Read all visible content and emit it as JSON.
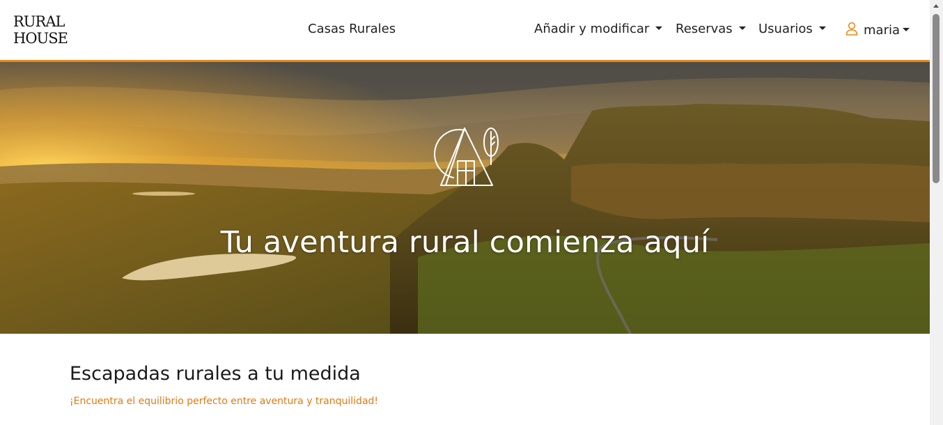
{
  "brand": {
    "line1": "RURAL",
    "line2": "HOUSE"
  },
  "nav": {
    "center_link": "Casas Rurales",
    "dropdowns": [
      {
        "label": "Añadir y modificar"
      },
      {
        "label": "Reservas"
      },
      {
        "label": "Usuarios"
      }
    ],
    "user": {
      "label": "maria",
      "icon": "user-icon"
    }
  },
  "hero": {
    "title": "Tu aventura rural comienza aquí",
    "logo_icon": "cabin-tree-logo-icon"
  },
  "content": {
    "title": "Escapadas rurales a tu medida",
    "subtitle": "¡Encuentra el equilibrio perfecto entre aventura y tranquilidad!"
  },
  "colors": {
    "accent": "#e8891c",
    "subtitle": "#e07a12"
  }
}
